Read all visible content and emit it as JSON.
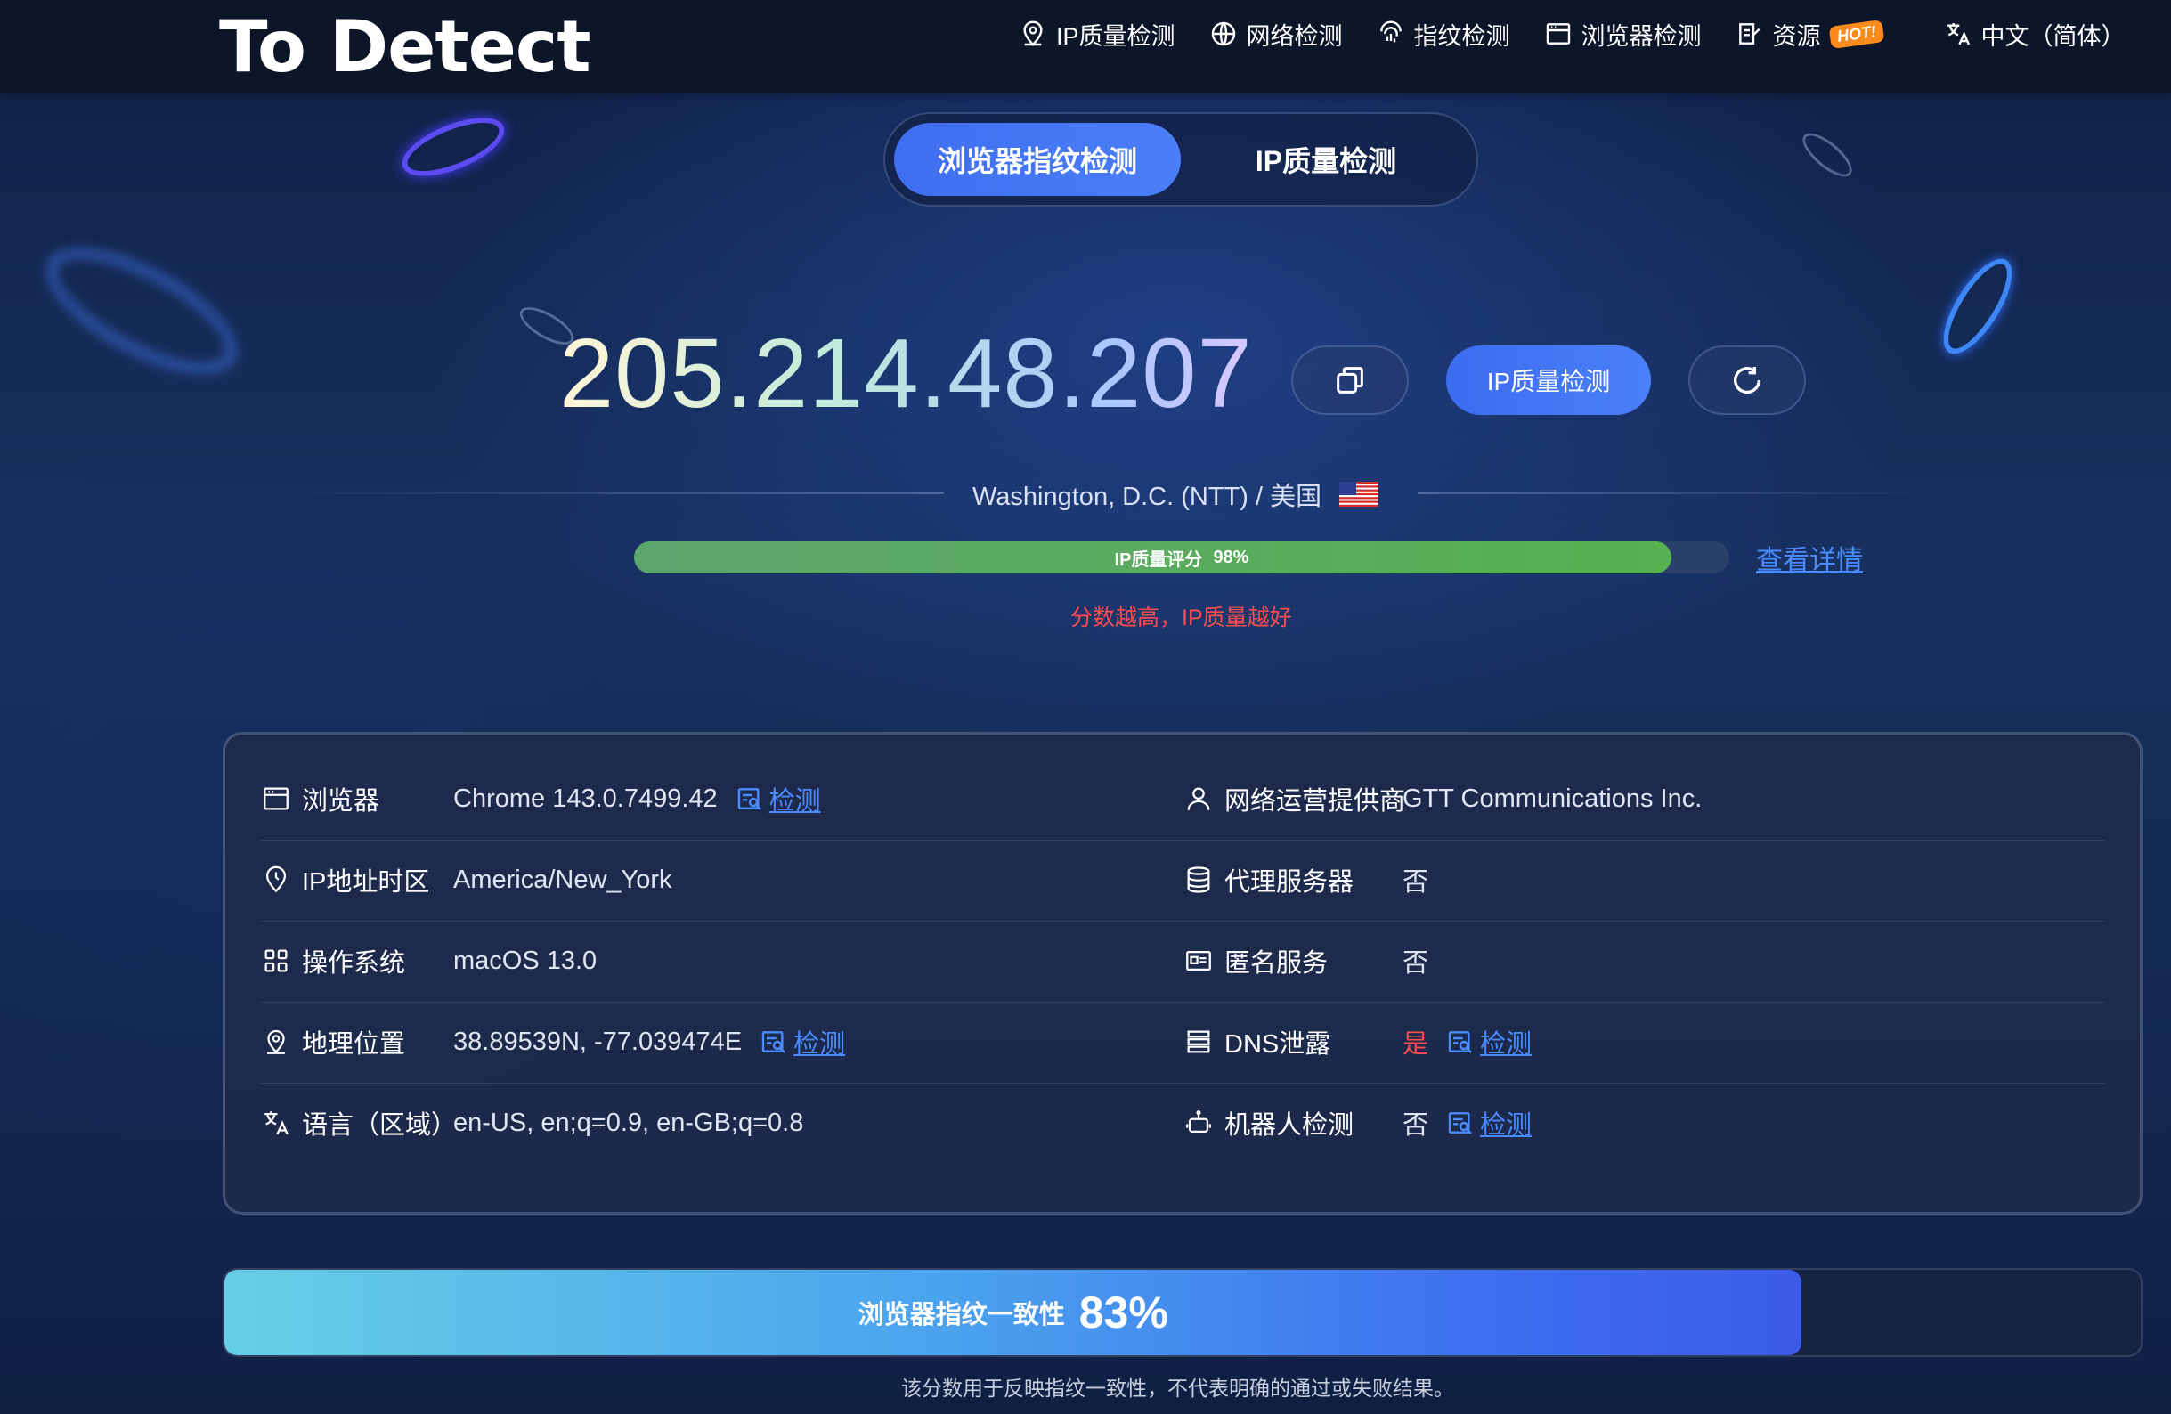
{
  "header": {
    "logo": "To Detect",
    "nav": [
      {
        "icon": "location-pin-icon",
        "label": "IP质量检测"
      },
      {
        "icon": "globe-icon",
        "label": "网络检测"
      },
      {
        "icon": "fingerprint-icon",
        "label": "指纹检测"
      },
      {
        "icon": "browser-window-icon",
        "label": "浏览器检测"
      },
      {
        "icon": "edit-document-icon",
        "label": "资源",
        "badge": "HOT!"
      },
      {
        "icon": "translate-icon",
        "label": "中文（简体）"
      }
    ]
  },
  "tabs": [
    {
      "label": "浏览器指纹检测",
      "active": true
    },
    {
      "label": "IP质量检测",
      "active": false
    }
  ],
  "ip": {
    "address": "205.214.48.207",
    "check_button": "IP质量检测",
    "location": "Washington, D.C. (NTT) / 美国"
  },
  "score": {
    "label": "IP质量评分",
    "value_text": "98%",
    "value": 0.98,
    "details_link": "查看详情",
    "note": "分数越高，IP质量越好"
  },
  "info": {
    "left": [
      {
        "icon": "browser-window-icon",
        "label": "浏览器",
        "value": "Chrome 143.0.7499.42",
        "link": "检测"
      },
      {
        "icon": "clock-pin-icon",
        "label": "IP地址时区",
        "value": "America/New_York"
      },
      {
        "icon": "grid-apps-icon",
        "label": "操作系统",
        "value": "macOS 13.0"
      },
      {
        "icon": "location-pin-icon",
        "label": "地理位置",
        "value": "38.89539N, -77.039474E",
        "link": "检测"
      },
      {
        "icon": "translate-icon",
        "label": "语言（区域）",
        "value": "en-US, en;q=0.9, en-GB;q=0.8"
      }
    ],
    "right": [
      {
        "icon": "user-icon",
        "label": "网络运营提供商",
        "value": "GTT Communications Inc."
      },
      {
        "icon": "database-icon",
        "label": "代理服务器",
        "value": "否"
      },
      {
        "icon": "id-card-icon",
        "label": "匿名服务",
        "value": "否"
      },
      {
        "icon": "server-stack-icon",
        "label": "DNS泄露",
        "value": "是",
        "link": "检测",
        "warn": true
      },
      {
        "icon": "robot-icon",
        "label": "机器人检测",
        "value": "否",
        "link": "检测"
      }
    ]
  },
  "consistency": {
    "label": "浏览器指纹一致性",
    "value_text": "83%",
    "value": 0.83,
    "note": "该分数用于反映指纹一致性，不代表明确的通过或失败结果。"
  },
  "colors": {
    "accent": "#3f6ef0",
    "link": "#4a8cff",
    "warn": "#ff4d4d",
    "score_green": "#56b150"
  }
}
